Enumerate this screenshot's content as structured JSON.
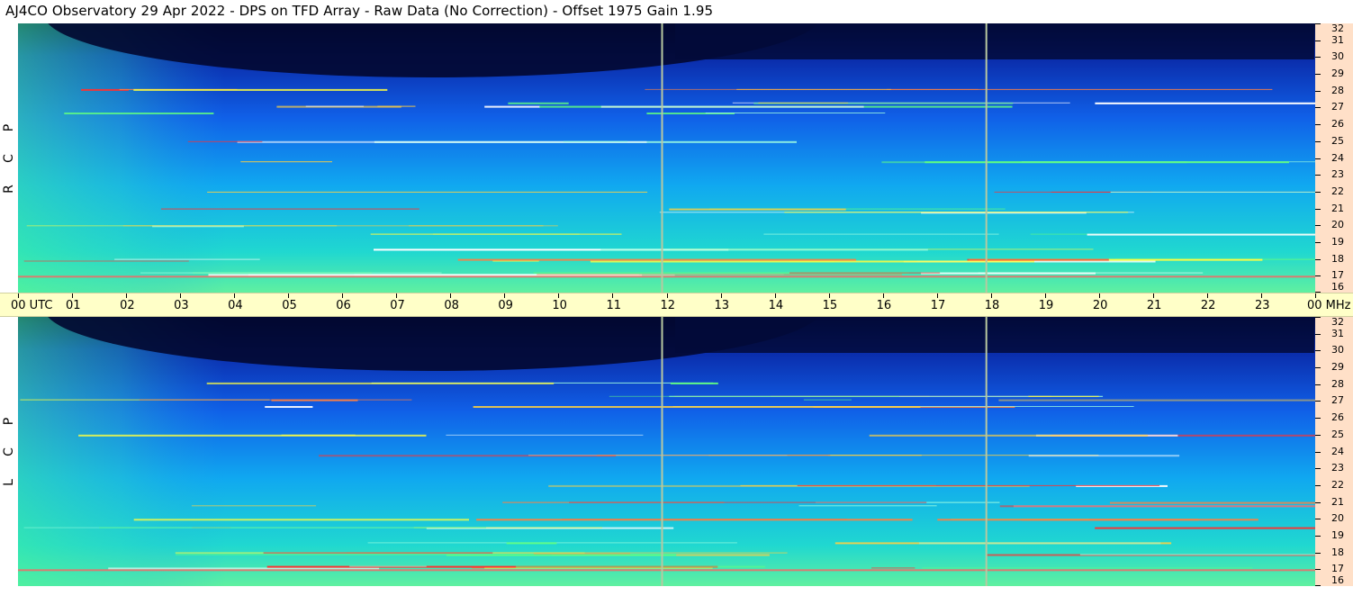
{
  "header": {
    "title": "AJ4CO Observatory  29 Apr 2022  -  DPS on TFD Array  -  Raw Data (No Correction)  -  Offset 1975  Gain 1.95"
  },
  "panels": {
    "top": {
      "polarization_letters": [
        "R",
        "C",
        "P"
      ]
    },
    "bottom": {
      "polarization_letters": [
        "L",
        "C",
        "P"
      ]
    }
  },
  "colors": {
    "x_axis_band": "#ffffc8",
    "y_axis_band": "#ffe0c8",
    "marker_line": "#b8c8a0"
  },
  "chart_data": [
    {
      "type": "heatmap",
      "title": "",
      "panel": "RCP",
      "xlabel": "UTC",
      "ylabel": "MHz",
      "x_ticks": [
        "00 UTC",
        "01",
        "02",
        "03",
        "04",
        "05",
        "06",
        "07",
        "08",
        "09",
        "10",
        "11",
        "12",
        "13",
        "14",
        "15",
        "16",
        "17",
        "18",
        "19",
        "20",
        "21",
        "22",
        "23",
        "00 MHz"
      ],
      "xlim_hours": [
        0,
        24
      ],
      "y_ticks": [
        "16",
        "17",
        "18",
        "19",
        "20",
        "21",
        "22",
        "23",
        "24",
        "25",
        "26",
        "27",
        "28",
        "29",
        "30",
        "31",
        "32"
      ],
      "ylim_mhz": [
        16,
        32
      ],
      "vertical_markers_utc": [
        11.9,
        17.9
      ]
    },
    {
      "type": "heatmap",
      "title": "",
      "panel": "LCP",
      "xlabel": "UTC",
      "ylabel": "MHz",
      "x_ticks": [
        "00 UTC",
        "01",
        "02",
        "03",
        "04",
        "05",
        "06",
        "07",
        "08",
        "09",
        "10",
        "11",
        "12",
        "13",
        "14",
        "15",
        "16",
        "17",
        "18",
        "19",
        "20",
        "21",
        "22",
        "23",
        "00 MHz"
      ],
      "xlim_hours": [
        0,
        24
      ],
      "y_ticks": [
        "16",
        "17",
        "18",
        "19",
        "20",
        "21",
        "22",
        "23",
        "24",
        "25",
        "26",
        "27",
        "28",
        "29",
        "30",
        "31",
        "32"
      ],
      "ylim_mhz": [
        16,
        32
      ],
      "vertical_markers_utc": [
        11.9,
        17.9
      ]
    }
  ]
}
